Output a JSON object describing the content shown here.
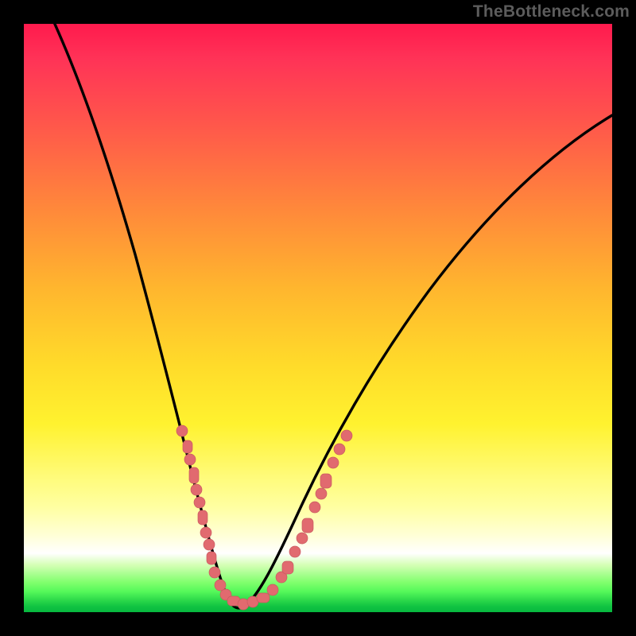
{
  "watermark": "TheBottleneck.com",
  "colors": {
    "background_frame": "#000000",
    "curve_stroke": "#000000",
    "marker_fill": "#e16a6f",
    "marker_stroke": "#c95a60",
    "gradient_top": "#ff1a4d",
    "gradient_mid": "#ffdb2a",
    "gradient_bottom": "#07b83f"
  },
  "chart_data": {
    "type": "line",
    "title": "",
    "xlabel": "",
    "ylabel": "",
    "xlim": [
      0,
      100
    ],
    "ylim": [
      0,
      100
    ],
    "grid": false,
    "legend": false,
    "note": "Bottleneck curve — vertex near x≈35, y≈0; no explicit axis tick labels shown in image, values estimated from position (0–100 scale).",
    "x": [
      0,
      4,
      8,
      12,
      16,
      20,
      24,
      27,
      30,
      33,
      35,
      37,
      40,
      44,
      50,
      56,
      64,
      74,
      86,
      100
    ],
    "y": [
      100,
      90,
      79,
      68,
      57,
      45,
      33,
      21,
      11,
      4,
      1,
      3,
      9,
      17,
      27,
      36,
      47,
      57,
      67,
      76
    ],
    "series": [
      {
        "name": "curve",
        "role": "main bottleneck curve",
        "x": [
          0,
          4,
          8,
          12,
          16,
          20,
          24,
          27,
          30,
          33,
          35,
          37,
          40,
          44,
          50,
          56,
          64,
          74,
          86,
          100
        ],
        "y": [
          100,
          90,
          79,
          68,
          57,
          45,
          33,
          21,
          11,
          4,
          1,
          3,
          9,
          17,
          27,
          36,
          47,
          57,
          67,
          76
        ]
      },
      {
        "name": "markers_left_arm",
        "role": "pink dot cluster along left descending arm",
        "x": [
          24.0,
          24.8,
          25.5,
          26.2,
          26.8,
          27.4,
          28.0,
          28.6,
          29.1,
          29.6,
          30.0
        ],
        "y": [
          33.0,
          30.0,
          27.0,
          24.0,
          21.5,
          19.0,
          16.5,
          14.0,
          12.0,
          10.0,
          8.5
        ]
      },
      {
        "name": "markers_trough",
        "role": "pink dot cluster across trough",
        "x": [
          31.0,
          32.0,
          33.0,
          34.0,
          35.0,
          36.0,
          37.0,
          38.0,
          39.0,
          40.0
        ],
        "y": [
          5.5,
          3.5,
          2.3,
          1.5,
          1.0,
          1.3,
          2.0,
          3.0,
          4.3,
          6.0
        ]
      },
      {
        "name": "markers_right_arm",
        "role": "pink dot cluster along right ascending arm",
        "x": [
          41.5,
          43.0,
          44.5,
          46.0,
          47.5,
          49.0,
          50.5,
          52.0
        ],
        "y": [
          9.0,
          12.0,
          15.0,
          18.0,
          20.5,
          23.0,
          25.5,
          28.0
        ]
      }
    ]
  }
}
